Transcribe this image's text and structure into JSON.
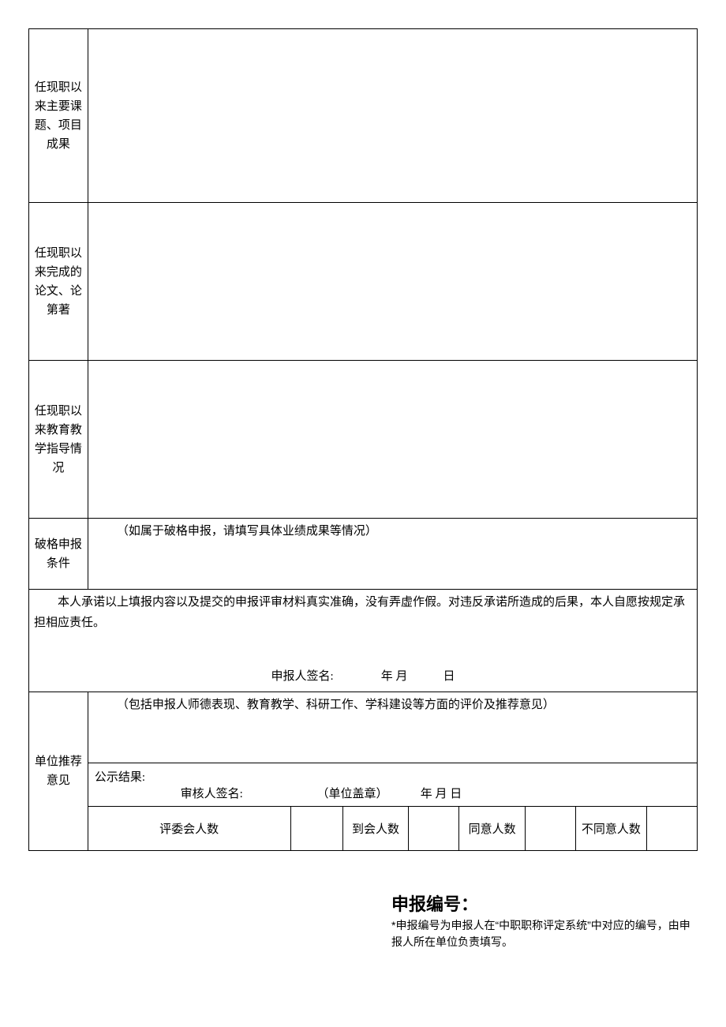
{
  "rows": {
    "projects_label": "任现职以来主要课题、项目成果",
    "papers_label": "任现职以来完成的论文、论第著",
    "teaching_label": "任现职以来教育教学指导情况",
    "exception_label": "破格申报条件",
    "exception_hint": "（如属于破格申报，请填写具体业绩成果等情况）",
    "recommend_label": "单位推荐意见",
    "recommend_hint": "（包括申报人师德表现、教育教学、科研工作、学科建设等方面的评价及推荐意见）"
  },
  "commitment": {
    "text": "本人承诺以上填报内容以及提交的申报评审材料真实准确，没有弄虚作假。对违反承诺所造成的后果，本人自愿按规定承担相应责任。",
    "sign_line": "申报人签名:                年 月            日"
  },
  "publicity": {
    "result_label": "公示结果:",
    "audit_line": "                             审核人签名:                         （单位盖章）           年 月 日"
  },
  "committee": {
    "total_label": "评委会人数",
    "present_label": "到会人数",
    "agree_label": "同意人数",
    "disagree_label": "不同意人数",
    "total_value": "",
    "present_value": "",
    "agree_value": "",
    "disagree_value": ""
  },
  "footer": {
    "title": "申报编号：",
    "note": "*申报编号为申报人在“中职职称评定系统”中对应的编号，由申报人所在单位负责填写。"
  }
}
